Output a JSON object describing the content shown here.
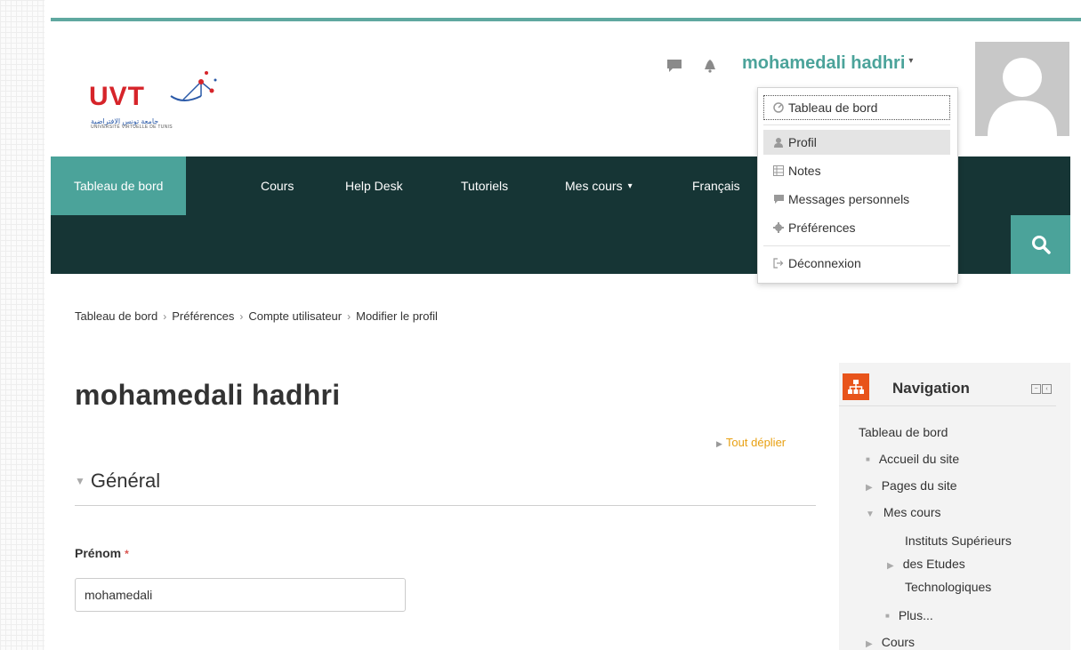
{
  "logo": {
    "text": "UVT",
    "sub1": "جامعة تونس الافتراضية",
    "sub2": "UNIVERSITÉ VIRTUELLE DE TUNIS"
  },
  "header": {
    "user_name": "mohamedali hadhri",
    "caret": "▾",
    "icons": [
      "chat-bubble-icon",
      "bell-icon",
      "avatar-icon"
    ]
  },
  "user_dropdown": {
    "items": [
      {
        "label": "Tableau de bord",
        "icon": "dashboard-icon"
      },
      {
        "label": "Profil",
        "icon": "user-icon"
      },
      {
        "label": "Notes",
        "icon": "grades-table-icon"
      },
      {
        "label": "Messages personnels",
        "icon": "chat-bubble-icon"
      },
      {
        "label": "Préférences",
        "icon": "gear-icon"
      },
      {
        "label": "Déconnexion",
        "icon": "logout-icon"
      }
    ]
  },
  "navbar": {
    "items": [
      {
        "label": "Tableau de bord"
      },
      {
        "label": "Cours"
      },
      {
        "label": "Help Desk"
      },
      {
        "label": "Tutoriels"
      },
      {
        "label": "Mes cours"
      },
      {
        "label": "Français"
      }
    ],
    "caret": "▾",
    "search_icon": "search-icon"
  },
  "breadcrumb": {
    "items": [
      "Tableau de bord",
      "Préférences",
      "Compte utilisateur",
      "Modifier le profil"
    ],
    "separator": "›"
  },
  "main": {
    "title": "mohamedali hadhri",
    "expand_all": "Tout déplier",
    "section_title": "Général",
    "first_name_label": "Prénom",
    "required_marker": "*",
    "first_name_value": "mohamedali"
  },
  "navigation_block": {
    "title": "Navigation",
    "dashboard": "Tableau de bord",
    "site_home": "Accueil du site",
    "site_pages": "Pages du site",
    "my_courses": "Mes cours",
    "institutes_line1": "Instituts Supérieurs",
    "institutes_line2": "des Etudes",
    "institutes_line3": "Technologiques",
    "more": "Plus...",
    "courses": "Cours"
  },
  "colors": {
    "teal": "#4ba39a",
    "dark_nav": "#163535",
    "orange_link": "#e8a012",
    "logo_red": "#d6242a",
    "nav_icon_orange": "#e8541b"
  }
}
